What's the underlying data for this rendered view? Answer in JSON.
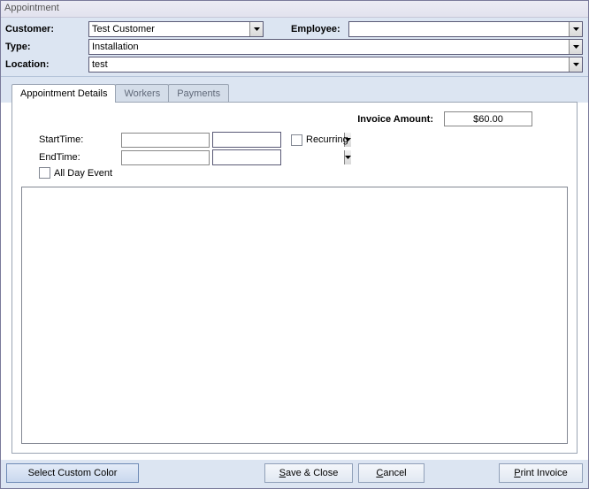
{
  "window": {
    "title": "Appointment"
  },
  "header": {
    "customer_label": "Customer:",
    "customer_value": "Test Customer",
    "employee_label": "Employee:",
    "employee_value": "",
    "type_label": "Type:",
    "type_value": "Installation",
    "location_label": "Location:",
    "location_value": "test"
  },
  "tabs": {
    "details": "Appointment Details",
    "workers": "Workers",
    "payments": "Payments"
  },
  "details": {
    "invoice_label": "Invoice Amount:",
    "invoice_value": "$60.00",
    "start_label": "StartTime:",
    "start_date": "",
    "start_time": "",
    "end_label": "EndTime:",
    "end_date": "",
    "end_time": "",
    "recurring_label": "Recurring",
    "allday_label": "All Day Event",
    "notes": ""
  },
  "footer": {
    "color_btn": "Select Custom Color",
    "save_btn": {
      "u": "S",
      "rest": "ave & Close"
    },
    "cancel_btn": {
      "u": "C",
      "rest": "ancel"
    },
    "print_btn": {
      "u": "P",
      "rest": "rint Invoice"
    }
  }
}
